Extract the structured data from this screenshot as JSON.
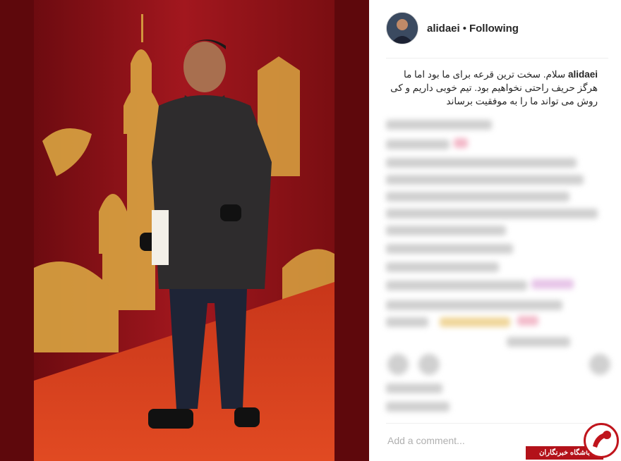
{
  "post": {
    "username": "alidaei",
    "separator": "•",
    "follow_status": "Following",
    "caption_user": "alidaei",
    "caption_text": "سلام. سخت ترین قرعه برای ما بود اما ما هرگز حریف راحتی نخواهیم بود. تیم خوبی داریم و کی روش می تواند ما را به موفقیت برساند"
  },
  "comment_box": {
    "placeholder": "Add a comment..."
  },
  "watermark": {
    "label": "باشگاه خبرنگاران"
  },
  "colors": {
    "carpet": "#d23a1c",
    "backdrop": "#9c161d",
    "gold": "#d9a441",
    "brand_red": "#c0141c"
  }
}
